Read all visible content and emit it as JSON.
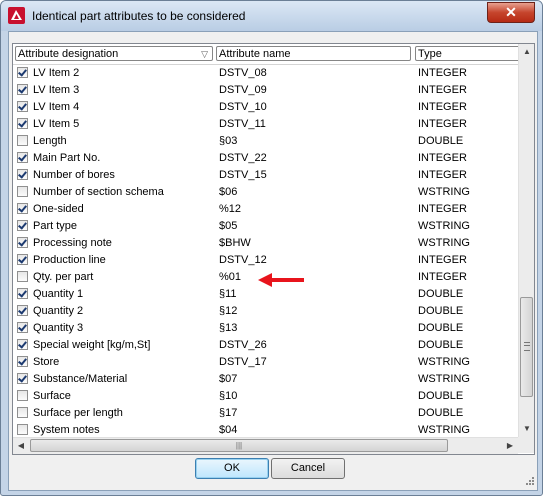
{
  "window": {
    "title": "Identical part attributes to be considered",
    "close_glyph": "✕"
  },
  "columns": {
    "designation": "Attribute designation",
    "name": "Attribute name",
    "type": "Type"
  },
  "rows": [
    {
      "checked": true,
      "designation": "LV Item 2",
      "name": "DSTV_08",
      "type": "INTEGER"
    },
    {
      "checked": true,
      "designation": "LV Item 3",
      "name": "DSTV_09",
      "type": "INTEGER"
    },
    {
      "checked": true,
      "designation": "LV Item 4",
      "name": "DSTV_10",
      "type": "INTEGER"
    },
    {
      "checked": true,
      "designation": "LV Item 5",
      "name": "DSTV_11",
      "type": "INTEGER"
    },
    {
      "checked": false,
      "designation": "Length",
      "name": "§03",
      "type": "DOUBLE"
    },
    {
      "checked": true,
      "designation": "Main Part No.",
      "name": "DSTV_22",
      "type": "INTEGER"
    },
    {
      "checked": true,
      "designation": "Number of bores",
      "name": "DSTV_15",
      "type": "INTEGER"
    },
    {
      "checked": false,
      "designation": "Number of section schema",
      "name": "$06",
      "type": "WSTRING"
    },
    {
      "checked": true,
      "designation": "One-sided",
      "name": "%12",
      "type": "INTEGER"
    },
    {
      "checked": true,
      "designation": "Part type",
      "name": "$05",
      "type": "WSTRING"
    },
    {
      "checked": true,
      "designation": "Processing note",
      "name": "$BHW",
      "type": "WSTRING"
    },
    {
      "checked": true,
      "designation": "Production line",
      "name": "DSTV_12",
      "type": "INTEGER"
    },
    {
      "checked": false,
      "designation": "Qty. per part",
      "name": "%01",
      "type": "INTEGER"
    },
    {
      "checked": true,
      "designation": "Quantity 1",
      "name": "§11",
      "type": "DOUBLE"
    },
    {
      "checked": true,
      "designation": "Quantity 2",
      "name": "§12",
      "type": "DOUBLE"
    },
    {
      "checked": true,
      "designation": "Quantity 3",
      "name": "§13",
      "type": "DOUBLE"
    },
    {
      "checked": true,
      "designation": "Special weight [kg/m,St]",
      "name": "DSTV_26",
      "type": "DOUBLE"
    },
    {
      "checked": true,
      "designation": "Store",
      "name": "DSTV_17",
      "type": "WSTRING"
    },
    {
      "checked": true,
      "designation": "Substance/Material",
      "name": "$07",
      "type": "WSTRING"
    },
    {
      "checked": false,
      "designation": "Surface",
      "name": "§10",
      "type": "DOUBLE"
    },
    {
      "checked": false,
      "designation": "Surface per length",
      "name": "§17",
      "type": "DOUBLE"
    },
    {
      "checked": false,
      "designation": "System notes",
      "name": "$04",
      "type": "WSTRING"
    }
  ],
  "buttons": {
    "ok": "OK",
    "cancel": "Cancel"
  },
  "colors": {
    "arrow": "#e8141c",
    "app_icon": "#c8102e"
  }
}
